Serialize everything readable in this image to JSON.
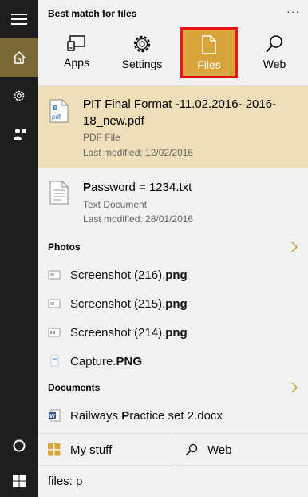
{
  "header": {
    "title": "Best match for files",
    "more_label": "···"
  },
  "filters": [
    {
      "label": "Apps",
      "icon": "apps-icon"
    },
    {
      "label": "Settings",
      "icon": "gear-icon"
    },
    {
      "label": "Files",
      "icon": "file-icon",
      "selected": true
    },
    {
      "label": "Web",
      "icon": "search-icon"
    }
  ],
  "results": [
    {
      "title_bold": "P",
      "title_rest": "IT Final Format -11.02.2016- 2016-",
      "title_line2": "18_new.pdf",
      "type": "PDF File",
      "modified": "Last modified: 12/02/2016",
      "icon": "pdf-icon"
    },
    {
      "title_bold": "P",
      "title_rest": "assword = 1234.txt",
      "type": "Text Document",
      "modified": "Last modified: 28/01/2016",
      "icon": "text-file-icon"
    }
  ],
  "photos": {
    "header": "Photos",
    "items": [
      {
        "name": "Screenshot (216).",
        "ext": "png"
      },
      {
        "name": "Screenshot (215).",
        "ext": "png"
      },
      {
        "name": "Screenshot (214).",
        "ext": "png"
      },
      {
        "name": "Capture.",
        "ext": "PNG"
      }
    ]
  },
  "documents": {
    "header": "Documents",
    "items": [
      {
        "pre": "Railways ",
        "bold": "P",
        "post": "ractice set 2.docx"
      }
    ]
  },
  "scopes": {
    "mystuff": "My stuff",
    "web": "Web"
  },
  "search": {
    "query": "files: p"
  },
  "colors": {
    "accent": "#d9a53a",
    "highlight": "#efdfb8",
    "rail": "#1f1f1f",
    "rail_active": "#7a6a3a",
    "outline": "#e8161b"
  }
}
